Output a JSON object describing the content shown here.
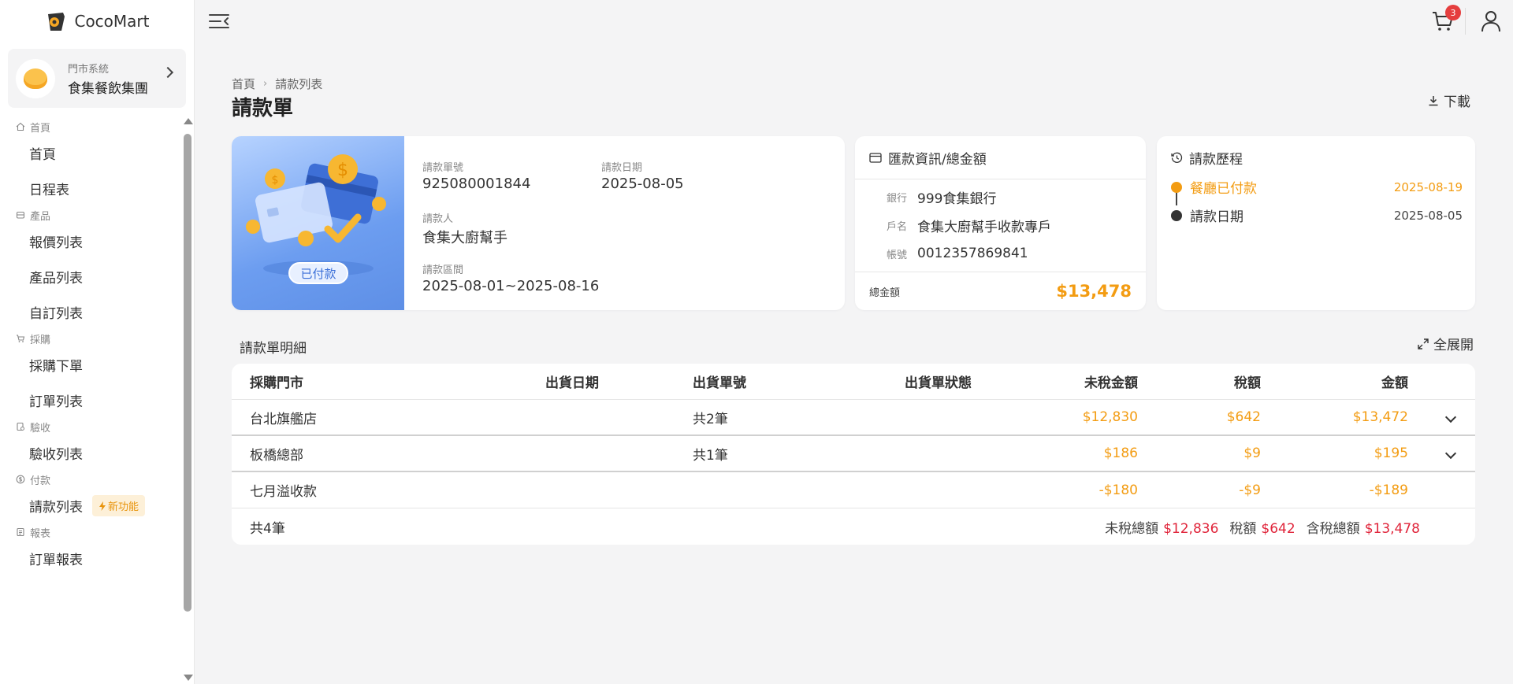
{
  "app": {
    "name": "CocoMart"
  },
  "store": {
    "subtitle": "門市系統",
    "name": "食集餐飲集團"
  },
  "nav": [
    {
      "group": "首頁",
      "items": [
        {
          "label": "首頁"
        },
        {
          "label": "日程表"
        }
      ]
    },
    {
      "group": "產品",
      "items": [
        {
          "label": "報價列表"
        },
        {
          "label": "產品列表"
        },
        {
          "label": "自訂列表"
        }
      ]
    },
    {
      "group": "採購",
      "items": [
        {
          "label": "採購下單"
        },
        {
          "label": "訂單列表"
        }
      ]
    },
    {
      "group": "驗收",
      "items": [
        {
          "label": "驗收列表"
        }
      ]
    },
    {
      "group": "付款",
      "items": [
        {
          "label": "請款列表",
          "badge": "新功能"
        }
      ]
    },
    {
      "group": "報表",
      "items": [
        {
          "label": "訂單報表"
        }
      ]
    }
  ],
  "topbar": {
    "cart_count": "3"
  },
  "breadcrumb": [
    "首頁",
    "請款列表"
  ],
  "page_title": "請款單",
  "download_label": "下載",
  "invoice": {
    "status": "已付款",
    "no_label": "請款單號",
    "no": "925080001844",
    "date_label": "請款日期",
    "date": "2025-08-05",
    "requester_label": "請款人",
    "requester": "食集大廚幫手",
    "period_label": "請款區間",
    "period": "2025-08-01~2025-08-16"
  },
  "bank": {
    "title": "匯款資訊/總金額",
    "bank_label": "銀行",
    "bank": "999食集銀行",
    "account_name_label": "戶名",
    "account_name": "食集大廚幫手收款專戶",
    "account_no_label": "帳號",
    "account_no": "0012357869841",
    "total_label": "總金額",
    "total": "$13,478"
  },
  "history": {
    "title": "請款歷程",
    "items": [
      {
        "label": "餐廳已付款",
        "date": "2025-08-19",
        "color": "#f39c12"
      },
      {
        "label": "請款日期",
        "date": "2025-08-05",
        "color": "#333333"
      }
    ]
  },
  "detail": {
    "title": "請款單明細",
    "expand_label": "全展開",
    "columns": [
      "採購門市",
      "出貨日期",
      "出貨單號",
      "出貨單狀態",
      "未稅金額",
      "稅額",
      "金額"
    ],
    "rows": [
      {
        "store": "台北旗艦店",
        "ship_date": "",
        "ship_no": "共2筆",
        "status": "",
        "pretax": "$12,830",
        "tax": "$642",
        "amount": "$13,472",
        "expandable": true
      },
      {
        "store": "板橋總部",
        "ship_date": "",
        "ship_no": "共1筆",
        "status": "",
        "pretax": "$186",
        "tax": "$9",
        "amount": "$195",
        "expandable": true
      },
      {
        "store": "七月溢收款",
        "ship_date": "",
        "ship_no": "",
        "status": "",
        "pretax": "-$180",
        "tax": "-$9",
        "amount": "-$189",
        "expandable": false
      }
    ],
    "footer": {
      "count": "共4筆",
      "pretax_label": "未稅總額",
      "pretax_total": "$12,836",
      "tax_label": "稅額",
      "tax_total": "$642",
      "total_label": "含稅總額",
      "total": "$13,478"
    }
  }
}
